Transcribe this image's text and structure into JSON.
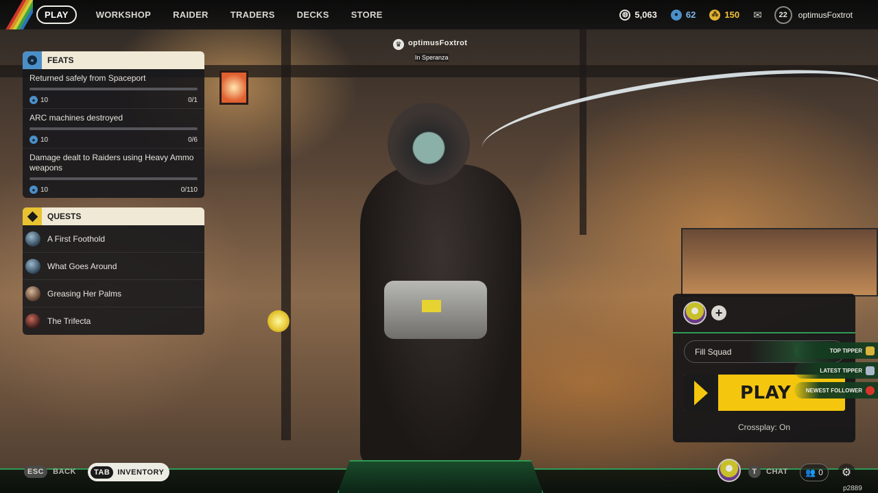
{
  "nav": {
    "items": [
      "PLAY",
      "WORKSHOP",
      "RAIDER",
      "TRADERS",
      "DECKS",
      "STORE"
    ],
    "active": "PLAY"
  },
  "currencies": {
    "coins": "5,063",
    "tokens": "62",
    "feathers": "150"
  },
  "player": {
    "level": "22",
    "username": "optimusFoxtrot",
    "location": "In Speranza"
  },
  "feats": {
    "title": "FEATS",
    "items": [
      {
        "title": "Returned safely from Spaceport",
        "reward": "10",
        "progress": "0/1",
        "fraction": 0
      },
      {
        "title": "ARC machines destroyed",
        "reward": "10",
        "progress": "0/6",
        "fraction": 0
      },
      {
        "title": "Damage dealt to Raiders using Heavy Ammo weapons",
        "reward": "10",
        "progress": "0/110",
        "fraction": 0
      }
    ]
  },
  "quests": {
    "title": "QUESTS",
    "items": [
      {
        "label": "A First Foothold"
      },
      {
        "label": "What Goes Around"
      },
      {
        "label": "Greasing Her Palms"
      },
      {
        "label": "The Trifecta"
      }
    ]
  },
  "squad": {
    "fill_label": "Fill Squad",
    "play_label": "PLAY",
    "crossplay": "Crossplay: On"
  },
  "alerts": {
    "top_tipper": "TOP TIPPER",
    "latest_tipper": "LATEST TIPPER",
    "newest_follower": "NEWEST FOLLOWER"
  },
  "bottom": {
    "esc_key": "ESC",
    "back_label": "BACK",
    "tab_key": "TAB",
    "inventory_label": "INVENTORY",
    "chat_key": "T",
    "chat_label": "CHAT",
    "friends_count": "0",
    "build": "p2889"
  },
  "icons": {
    "coins": "coin-icon",
    "tokens": "token-icon",
    "feathers": "feather-icon",
    "mail": "mail-icon",
    "settings": "gear-icon",
    "friends": "friends-icon"
  },
  "colors": {
    "accent_yellow": "#f5c60e",
    "accent_blue": "#4b8fc8",
    "accent_green": "#2f9c55",
    "panel_header": "#efe9d6"
  }
}
